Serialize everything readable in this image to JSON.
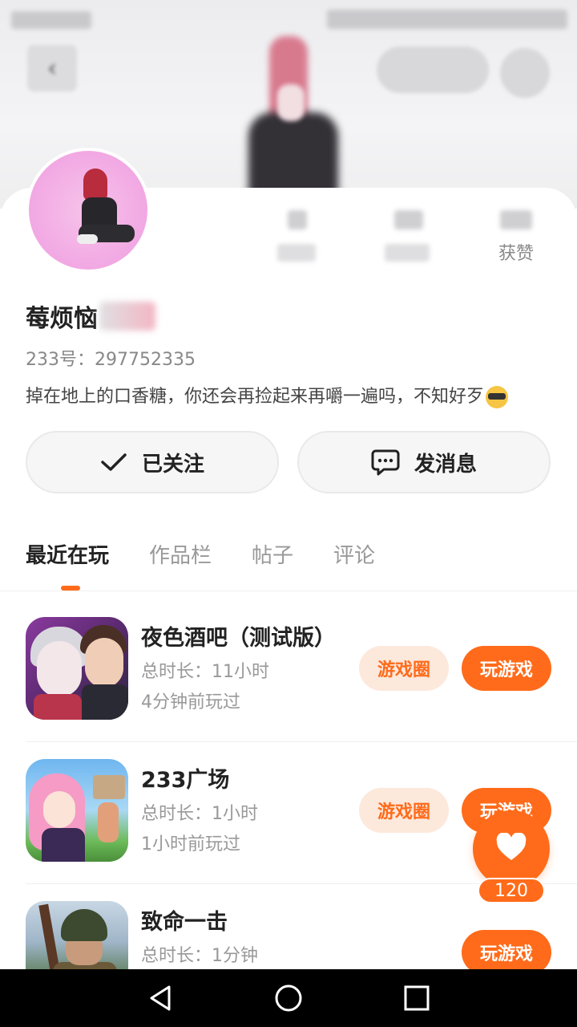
{
  "profile": {
    "nickname": "莓烦恼",
    "uid": "233号：297752335",
    "bio": "掉在地上的口香糖，你还会再捡起来再嚼一遍吗，不知好歹",
    "stats_label_likes": "获赞"
  },
  "actions": {
    "follow_label": "已关注",
    "message_label": "发消息"
  },
  "tabs": [
    "最近在玩",
    "作品栏",
    "帖子",
    "评论"
  ],
  "games": [
    {
      "title": "夜色酒吧（测试版）",
      "duration": "总时长：11小时",
      "last_played": "4分钟前玩过",
      "circle_label": "游戏圈",
      "play_label": "玩游戏"
    },
    {
      "title": "233广场",
      "duration": "总时长：1小时",
      "last_played": "1小时前玩过",
      "circle_label": "游戏圈",
      "play_label": "玩游戏"
    },
    {
      "title": "致命一击",
      "duration": "总时长：1分钟",
      "last_played": "",
      "circle_label": "",
      "play_label": "玩游戏"
    }
  ],
  "like_fab": {
    "count": "120"
  },
  "colors": {
    "accent": "#ff6b1a",
    "accent_light": "#fde8dc"
  }
}
